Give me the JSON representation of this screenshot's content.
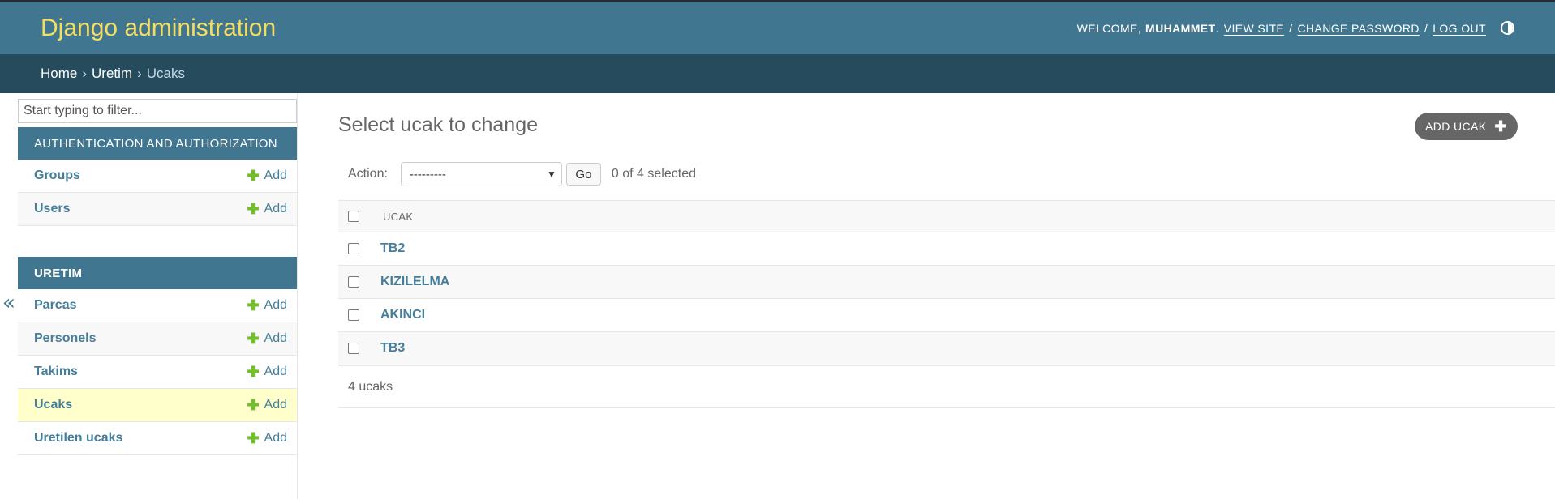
{
  "header": {
    "site_title": "Django administration",
    "welcome": "WELCOME,",
    "username": "MUHAMMET",
    "view_site": "VIEW SITE",
    "change_password": "CHANGE PASSWORD",
    "log_out": "LOG OUT",
    "separator": "/"
  },
  "breadcrumbs": {
    "home": "Home",
    "app": "Uretim",
    "current": "Ucaks",
    "separator": "›"
  },
  "sidebar": {
    "toggle": "«",
    "filter_placeholder": "Start typing to filter...",
    "modules": [
      {
        "caption": "AUTHENTICATION AND AUTHORIZATION",
        "models": [
          {
            "name": "Groups",
            "add": "Add"
          },
          {
            "name": "Users",
            "add": "Add"
          }
        ]
      },
      {
        "caption": "URETIM",
        "models": [
          {
            "name": "Parcas",
            "add": "Add"
          },
          {
            "name": "Personels",
            "add": "Add"
          },
          {
            "name": "Takims",
            "add": "Add"
          },
          {
            "name": "Ucaks",
            "add": "Add"
          },
          {
            "name": "Uretilen ucaks",
            "add": "Add"
          }
        ]
      }
    ]
  },
  "content": {
    "title": "Select ucak to change",
    "add_button": "ADD UCAK",
    "action_label": "Action:",
    "action_selected": "---------",
    "go_button": "Go",
    "action_counter": "0 of 4 selected",
    "column_header": "UCAK",
    "rows": [
      "TB2",
      "KIZILELMA",
      "AKINCI",
      "TB3"
    ],
    "paginator": "4 ucaks"
  },
  "colors": {
    "header_bg": "#417690",
    "breadcrumb_bg": "#264b5d",
    "brand_yellow": "#f5dd5d",
    "link_blue": "#447e9b",
    "add_green": "#70bf2b",
    "selected_row": "#ffffcc"
  },
  "icons": {
    "theme_toggle": "half-circle-icon",
    "add": "plus-icon",
    "select_arrow": "chevron-down-icon"
  }
}
